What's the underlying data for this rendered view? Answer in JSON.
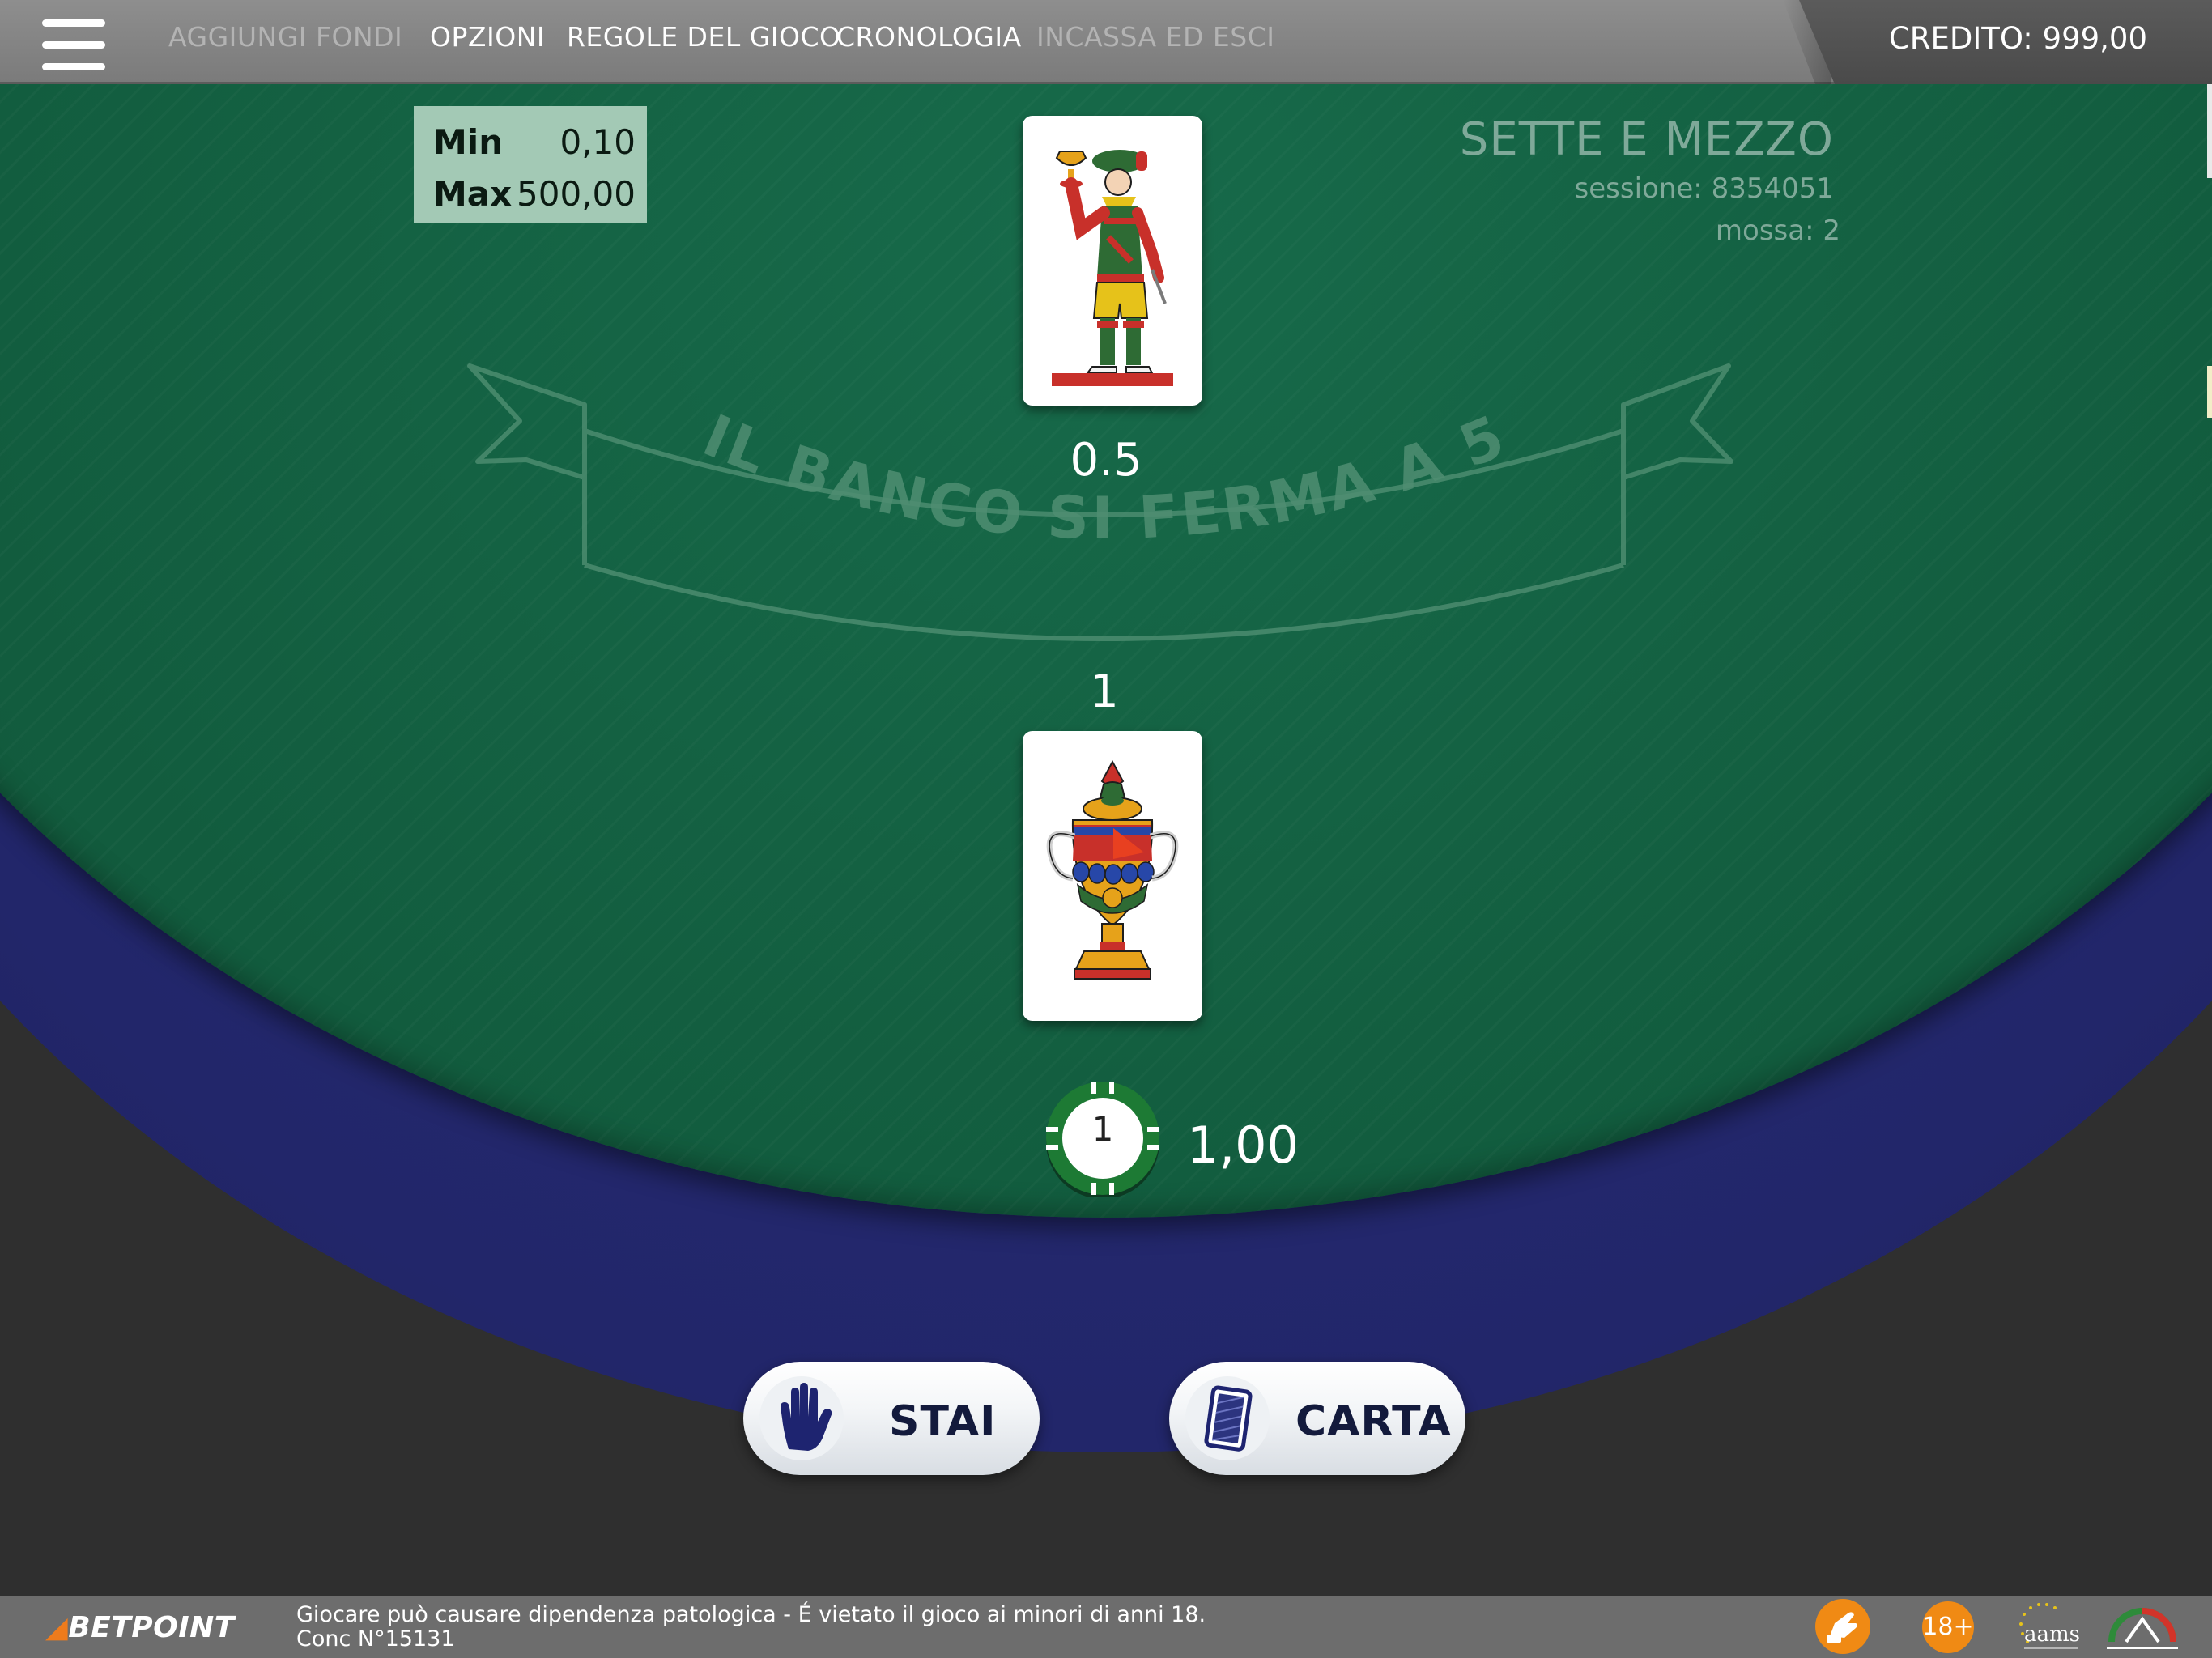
{
  "topbar": {
    "menu": {
      "add_funds": "AGGIUNGI FONDI",
      "options": "OPZIONI",
      "rules": "REGOLE DEL GIOCO",
      "history": "CRONOLOGIA",
      "cash_out": "INCASSA ED ESCI"
    },
    "credit": "CREDITO: 999,00"
  },
  "table": {
    "limits": {
      "min_label": "Min",
      "min_value": "0,10",
      "max_label": "Max",
      "max_value": "500,00"
    },
    "game": {
      "title": "SETTE E MEZZO",
      "session": "sessione: 8354051",
      "move": "mossa: 2"
    },
    "banner_text": "IL BANCO SI FERMA A 5",
    "dealer": {
      "score": "0.5",
      "card": "fante-di-coppe"
    },
    "player": {
      "score": "1",
      "card": "asso-di-coppe"
    },
    "bet": {
      "chip_value": "1",
      "amount": "1,00"
    }
  },
  "actions": {
    "stand": "STAI",
    "hit": "CARTA"
  },
  "footer": {
    "brand": "BETPOINT",
    "disclaimer_line1": "Giocare può causare dipendenza patologica - É vietato il gioco ai minori di anni 18.",
    "disclaimer_line2": "Conc N°15131",
    "age_badge": "18+",
    "aams": "aams"
  },
  "colors": {
    "felt": "#135f40",
    "rail": "#22266a",
    "topbar": "#868686",
    "footer": "#6d6d6d",
    "accent": "#f08a14",
    "button_text": "#131a3c"
  }
}
